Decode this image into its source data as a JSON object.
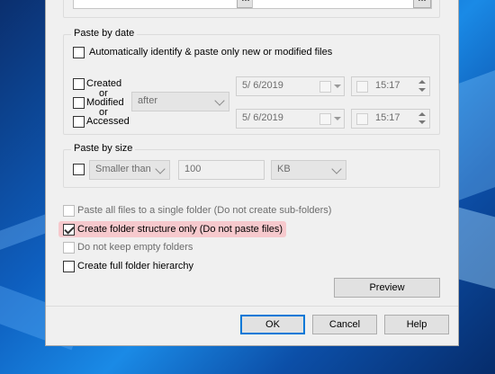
{
  "paste_by_date": {
    "title": "Paste by date",
    "auto_identify_label": "Automatically identify & paste only new or modified files",
    "created_label": "Created",
    "or1": "or",
    "modified_label": "Modified",
    "or2": "or",
    "accessed_label": "Accessed",
    "relation_value": "after",
    "date1": "5/  6/2019",
    "time1": "15:17",
    "date2": "5/  6/2019",
    "time2": "15:17"
  },
  "paste_by_size": {
    "title": "Paste by size",
    "comparison_value": "Smaller than",
    "size_value": "100",
    "unit_value": "KB"
  },
  "options": {
    "single_folder_label": "Paste all files to a single folder (Do not create sub-folders)",
    "structure_only_label": "Create folder structure only (Do not paste files)",
    "no_empty_label": "Do not keep empty folders",
    "full_hierarchy_label": "Create full folder hierarchy",
    "preview_label": "Preview"
  },
  "footer": {
    "ok_label": "OK",
    "cancel_label": "Cancel",
    "help_label": "Help"
  },
  "top": {
    "ellipsis1": "...",
    "ellipsis2": "..."
  },
  "colors": {
    "highlight": "#f6c9cd",
    "default_button_border": "#0078d7"
  }
}
